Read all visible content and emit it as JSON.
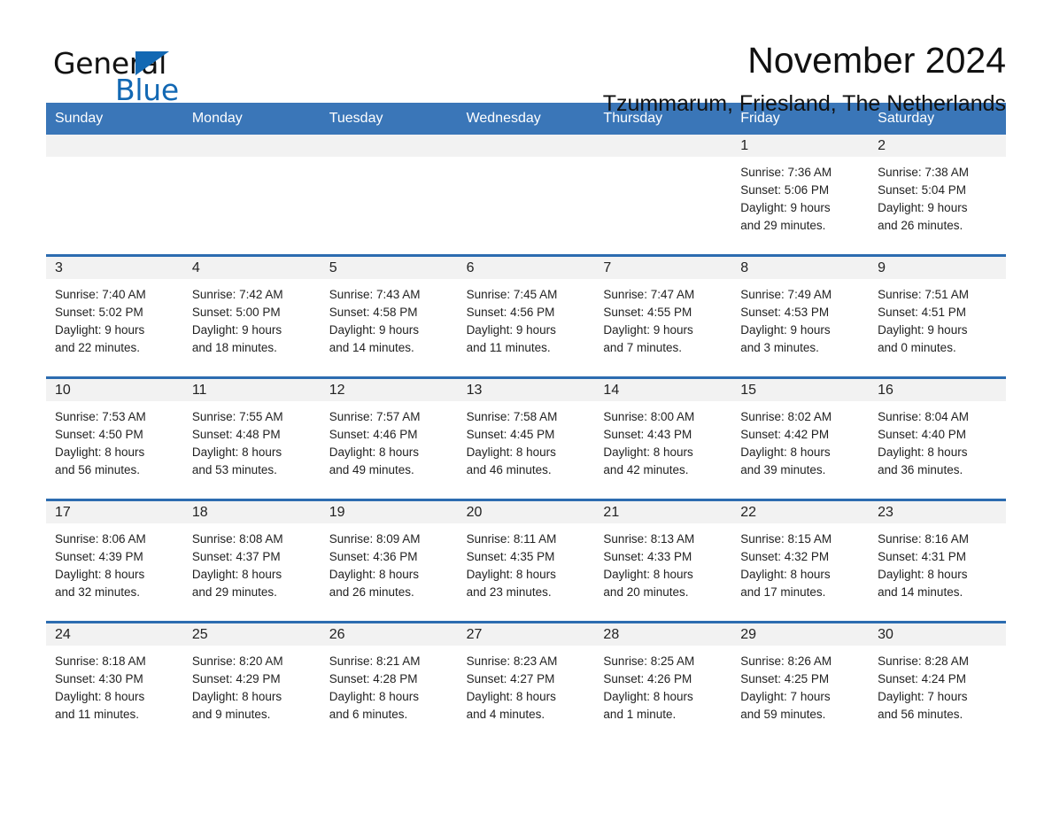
{
  "logo": {
    "word_one": "General",
    "word_two": "Blue",
    "triangle_color": "#1268b3"
  },
  "header": {
    "title": "November 2024",
    "subtitle": "Tzummarum, Friesland, The Netherlands"
  },
  "colors": {
    "header_blue": "#3a76b8",
    "row_rule_blue": "#2c6cb0",
    "day_band_gray": "#f2f2f2",
    "text": "#222222"
  },
  "weekday_headers": [
    "Sunday",
    "Monday",
    "Tuesday",
    "Wednesday",
    "Thursday",
    "Friday",
    "Saturday"
  ],
  "weeks": [
    [
      {
        "day": "",
        "lines": []
      },
      {
        "day": "",
        "lines": []
      },
      {
        "day": "",
        "lines": []
      },
      {
        "day": "",
        "lines": []
      },
      {
        "day": "",
        "lines": []
      },
      {
        "day": "1",
        "lines": [
          "Sunrise: 7:36 AM",
          "Sunset: 5:06 PM",
          "Daylight: 9 hours",
          "and 29 minutes."
        ]
      },
      {
        "day": "2",
        "lines": [
          "Sunrise: 7:38 AM",
          "Sunset: 5:04 PM",
          "Daylight: 9 hours",
          "and 26 minutes."
        ]
      }
    ],
    [
      {
        "day": "3",
        "lines": [
          "Sunrise: 7:40 AM",
          "Sunset: 5:02 PM",
          "Daylight: 9 hours",
          "and 22 minutes."
        ]
      },
      {
        "day": "4",
        "lines": [
          "Sunrise: 7:42 AM",
          "Sunset: 5:00 PM",
          "Daylight: 9 hours",
          "and 18 minutes."
        ]
      },
      {
        "day": "5",
        "lines": [
          "Sunrise: 7:43 AM",
          "Sunset: 4:58 PM",
          "Daylight: 9 hours",
          "and 14 minutes."
        ]
      },
      {
        "day": "6",
        "lines": [
          "Sunrise: 7:45 AM",
          "Sunset: 4:56 PM",
          "Daylight: 9 hours",
          "and 11 minutes."
        ]
      },
      {
        "day": "7",
        "lines": [
          "Sunrise: 7:47 AM",
          "Sunset: 4:55 PM",
          "Daylight: 9 hours",
          "and 7 minutes."
        ]
      },
      {
        "day": "8",
        "lines": [
          "Sunrise: 7:49 AM",
          "Sunset: 4:53 PM",
          "Daylight: 9 hours",
          "and 3 minutes."
        ]
      },
      {
        "day": "9",
        "lines": [
          "Sunrise: 7:51 AM",
          "Sunset: 4:51 PM",
          "Daylight: 9 hours",
          "and 0 minutes."
        ]
      }
    ],
    [
      {
        "day": "10",
        "lines": [
          "Sunrise: 7:53 AM",
          "Sunset: 4:50 PM",
          "Daylight: 8 hours",
          "and 56 minutes."
        ]
      },
      {
        "day": "11",
        "lines": [
          "Sunrise: 7:55 AM",
          "Sunset: 4:48 PM",
          "Daylight: 8 hours",
          "and 53 minutes."
        ]
      },
      {
        "day": "12",
        "lines": [
          "Sunrise: 7:57 AM",
          "Sunset: 4:46 PM",
          "Daylight: 8 hours",
          "and 49 minutes."
        ]
      },
      {
        "day": "13",
        "lines": [
          "Sunrise: 7:58 AM",
          "Sunset: 4:45 PM",
          "Daylight: 8 hours",
          "and 46 minutes."
        ]
      },
      {
        "day": "14",
        "lines": [
          "Sunrise: 8:00 AM",
          "Sunset: 4:43 PM",
          "Daylight: 8 hours",
          "and 42 minutes."
        ]
      },
      {
        "day": "15",
        "lines": [
          "Sunrise: 8:02 AM",
          "Sunset: 4:42 PM",
          "Daylight: 8 hours",
          "and 39 minutes."
        ]
      },
      {
        "day": "16",
        "lines": [
          "Sunrise: 8:04 AM",
          "Sunset: 4:40 PM",
          "Daylight: 8 hours",
          "and 36 minutes."
        ]
      }
    ],
    [
      {
        "day": "17",
        "lines": [
          "Sunrise: 8:06 AM",
          "Sunset: 4:39 PM",
          "Daylight: 8 hours",
          "and 32 minutes."
        ]
      },
      {
        "day": "18",
        "lines": [
          "Sunrise: 8:08 AM",
          "Sunset: 4:37 PM",
          "Daylight: 8 hours",
          "and 29 minutes."
        ]
      },
      {
        "day": "19",
        "lines": [
          "Sunrise: 8:09 AM",
          "Sunset: 4:36 PM",
          "Daylight: 8 hours",
          "and 26 minutes."
        ]
      },
      {
        "day": "20",
        "lines": [
          "Sunrise: 8:11 AM",
          "Sunset: 4:35 PM",
          "Daylight: 8 hours",
          "and 23 minutes."
        ]
      },
      {
        "day": "21",
        "lines": [
          "Sunrise: 8:13 AM",
          "Sunset: 4:33 PM",
          "Daylight: 8 hours",
          "and 20 minutes."
        ]
      },
      {
        "day": "22",
        "lines": [
          "Sunrise: 8:15 AM",
          "Sunset: 4:32 PM",
          "Daylight: 8 hours",
          "and 17 minutes."
        ]
      },
      {
        "day": "23",
        "lines": [
          "Sunrise: 8:16 AM",
          "Sunset: 4:31 PM",
          "Daylight: 8 hours",
          "and 14 minutes."
        ]
      }
    ],
    [
      {
        "day": "24",
        "lines": [
          "Sunrise: 8:18 AM",
          "Sunset: 4:30 PM",
          "Daylight: 8 hours",
          "and 11 minutes."
        ]
      },
      {
        "day": "25",
        "lines": [
          "Sunrise: 8:20 AM",
          "Sunset: 4:29 PM",
          "Daylight: 8 hours",
          "and 9 minutes."
        ]
      },
      {
        "day": "26",
        "lines": [
          "Sunrise: 8:21 AM",
          "Sunset: 4:28 PM",
          "Daylight: 8 hours",
          "and 6 minutes."
        ]
      },
      {
        "day": "27",
        "lines": [
          "Sunrise: 8:23 AM",
          "Sunset: 4:27 PM",
          "Daylight: 8 hours",
          "and 4 minutes."
        ]
      },
      {
        "day": "28",
        "lines": [
          "Sunrise: 8:25 AM",
          "Sunset: 4:26 PM",
          "Daylight: 8 hours",
          "and 1 minute."
        ]
      },
      {
        "day": "29",
        "lines": [
          "Sunrise: 8:26 AM",
          "Sunset: 4:25 PM",
          "Daylight: 7 hours",
          "and 59 minutes."
        ]
      },
      {
        "day": "30",
        "lines": [
          "Sunrise: 8:28 AM",
          "Sunset: 4:24 PM",
          "Daylight: 7 hours",
          "and 56 minutes."
        ]
      }
    ]
  ]
}
